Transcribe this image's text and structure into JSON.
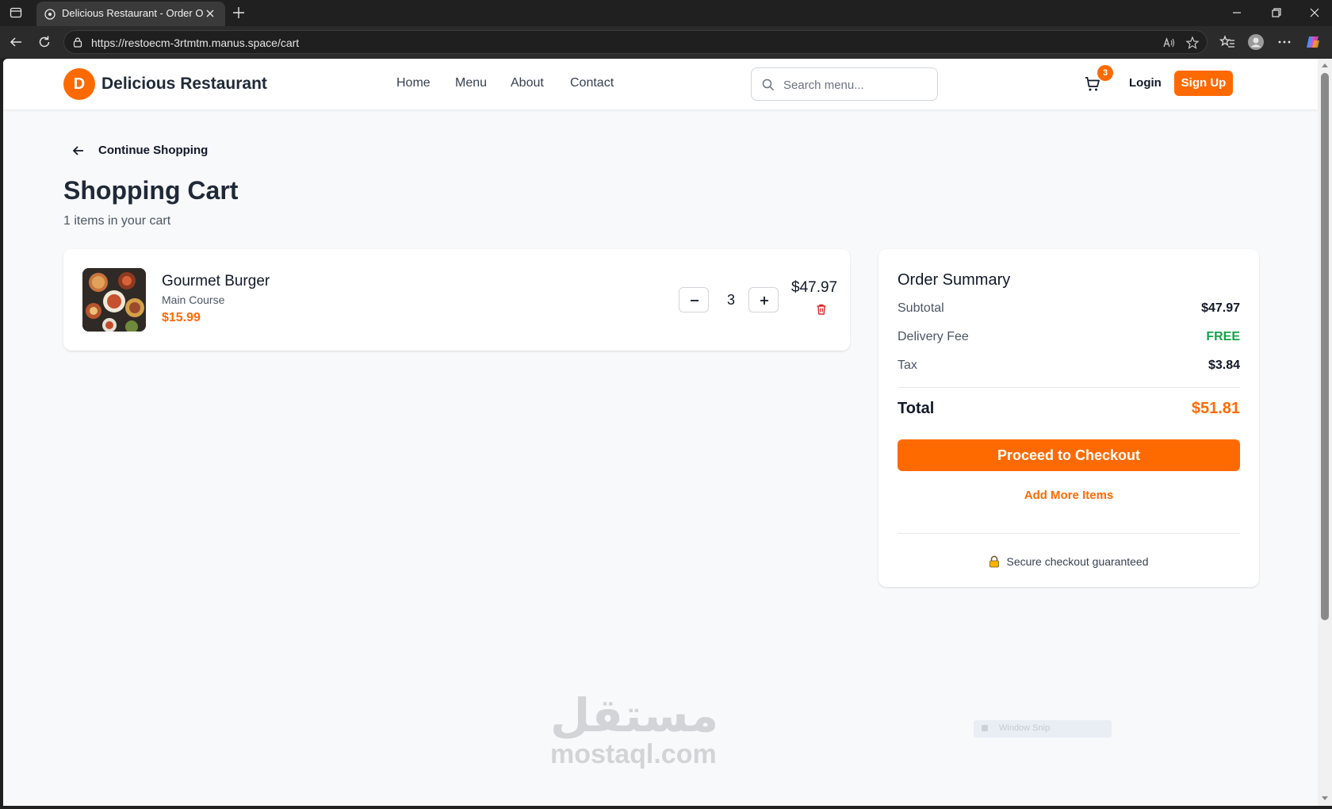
{
  "browser": {
    "tab_title": "Delicious Restaurant - Order Online",
    "url": "https://restoecm-3rtmtm.manus.space/cart"
  },
  "header": {
    "logo_letter": "D",
    "brand": "Delicious Restaurant",
    "nav": [
      "Home",
      "Menu",
      "About",
      "Contact"
    ],
    "search_placeholder": "Search menu...",
    "cart_count": "3",
    "login": "Login",
    "signup": "Sign Up"
  },
  "page": {
    "continue_label": "Continue Shopping",
    "title": "Shopping Cart",
    "items_count": "1 items in your cart"
  },
  "cart_items": [
    {
      "name": "Gourmet Burger",
      "category": "Main Course",
      "price": "$15.99",
      "quantity": "3",
      "line_total": "$47.97"
    }
  ],
  "summary": {
    "title": "Order Summary",
    "subtotal_label": "Subtotal",
    "subtotal": "$47.97",
    "delivery_label": "Delivery Fee",
    "delivery": "FREE",
    "tax_label": "Tax",
    "tax": "$3.84",
    "total_label": "Total",
    "total": "$51.81",
    "checkout": "Proceed to Checkout",
    "add_more": "Add More Items",
    "secure": "Secure checkout guaranteed"
  },
  "overlay": {
    "watermark_ar": "مستقل",
    "watermark_en": "mostaql.com",
    "snip_label": "Window Snip"
  },
  "colors": {
    "accent": "#ff6a00",
    "free": "#16a34a",
    "danger": "#dc2626"
  },
  "icons": {
    "back": "arrow-left-icon",
    "cart": "shopping-cart-icon",
    "search": "search-icon",
    "trash": "trash-icon",
    "lock": "lock-icon"
  }
}
